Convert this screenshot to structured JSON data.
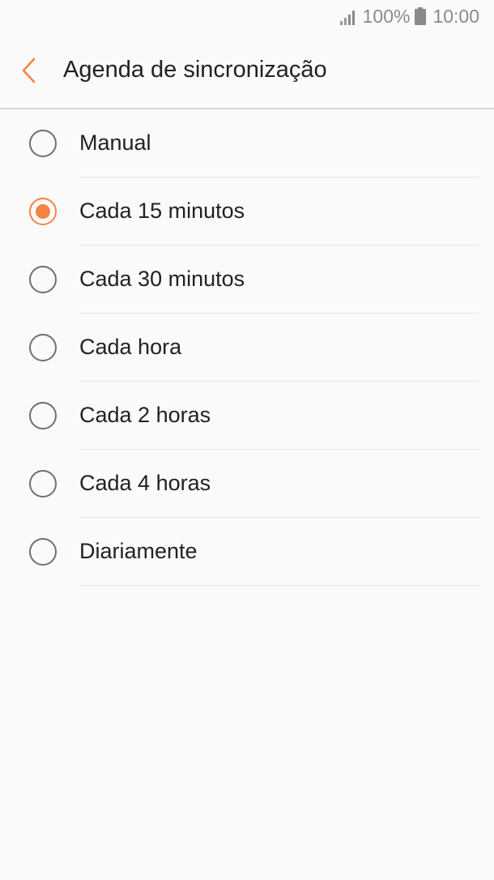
{
  "status_bar": {
    "battery_percent": "100%",
    "time": "10:00",
    "icons": [
      "signal-icon",
      "battery-icon"
    ]
  },
  "header": {
    "title": "Agenda de sincronização",
    "back_icon": "chevron-left-icon",
    "accent_color": "#f58442"
  },
  "options": [
    {
      "label": "Manual",
      "selected": false
    },
    {
      "label": "Cada 15 minutos",
      "selected": true
    },
    {
      "label": "Cada 30 minutos",
      "selected": false
    },
    {
      "label": "Cada hora",
      "selected": false
    },
    {
      "label": "Cada 2 horas",
      "selected": false
    },
    {
      "label": "Cada 4 horas",
      "selected": false
    },
    {
      "label": "Diariamente",
      "selected": false
    }
  ]
}
